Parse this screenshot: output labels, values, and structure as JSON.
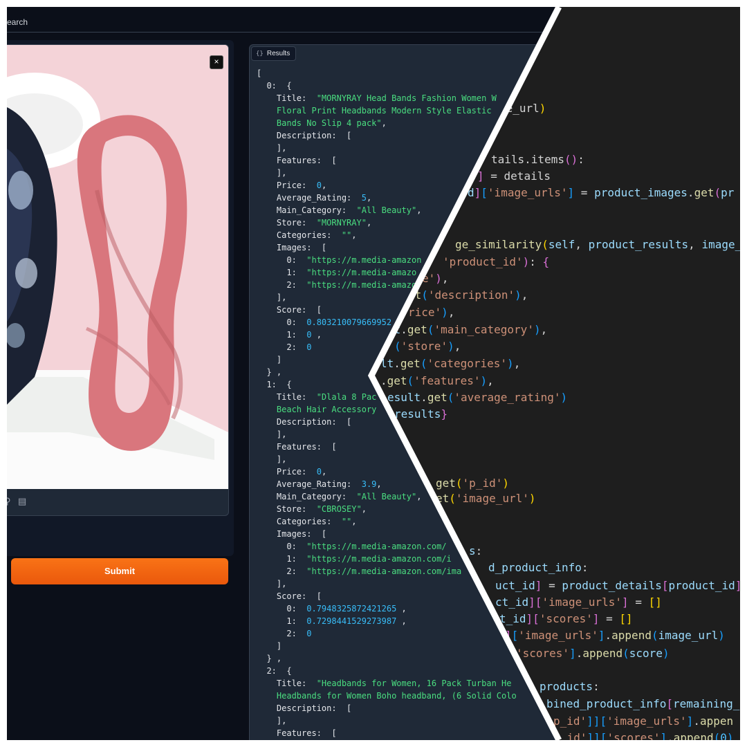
{
  "topbar": {
    "tab_label": "earch"
  },
  "image_panel": {
    "close_symbol": "×",
    "tool_icons": [
      "search-icon",
      "clipboard-icon"
    ]
  },
  "submit_button": {
    "label": "Submit"
  },
  "results_panel": {
    "label": "Results",
    "label_icon": "{}"
  },
  "json_lines": [
    [
      [
        "p",
        "["
      ]
    ],
    [
      [
        "p",
        "  0:  {"
      ]
    ],
    [
      [
        "k",
        "    Title:  "
      ],
      [
        "s",
        "\"MORNYRAY Head Bands Fashion Women W"
      ]
    ],
    [
      [
        "s",
        "    Floral Print Headbands Modern Style Elastic"
      ]
    ],
    [
      [
        "s",
        "    Bands No Slip 4 pack\""
      ],
      [
        "p",
        ","
      ]
    ],
    [
      [
        "k",
        "    Description:  ["
      ]
    ],
    [
      [
        "p",
        "    ],"
      ]
    ],
    [
      [
        "k",
        "    Features:  ["
      ]
    ],
    [
      [
        "p",
        "    ],"
      ]
    ],
    [
      [
        "k",
        "    Price:  "
      ],
      [
        "n",
        "0"
      ],
      [
        "p",
        ","
      ]
    ],
    [
      [
        "k",
        "    Average_Rating:  "
      ],
      [
        "n",
        "5"
      ],
      [
        "p",
        ","
      ]
    ],
    [
      [
        "k",
        "    Main_Category:  "
      ],
      [
        "s",
        "\"All Beauty\""
      ],
      [
        "p",
        ","
      ]
    ],
    [
      [
        "k",
        "    Store:  "
      ],
      [
        "s",
        "\"MORNYRAY\""
      ],
      [
        "p",
        ","
      ]
    ],
    [
      [
        "k",
        "    Categories:  "
      ],
      [
        "s",
        "\"\""
      ],
      [
        "p",
        ","
      ]
    ],
    [
      [
        "k",
        "    Images:  ["
      ]
    ],
    [
      [
        "k",
        "      0:  "
      ],
      [
        "s",
        "\"https://m.media-amazon"
      ]
    ],
    [
      [
        "k",
        "      1:  "
      ],
      [
        "s",
        "\"https://m.media-amazo"
      ]
    ],
    [
      [
        "k",
        "      2:  "
      ],
      [
        "s",
        "\"https://m.media-amazo"
      ]
    ],
    [
      [
        "p",
        "    ],"
      ]
    ],
    [
      [
        "k",
        "    Score:  ["
      ]
    ],
    [
      [
        "k",
        "      0:  "
      ],
      [
        "n",
        "0.803210079669952"
      ]
    ],
    [
      [
        "k",
        "      1:  "
      ],
      [
        "n",
        "0"
      ],
      [
        "p",
        " ,"
      ]
    ],
    [
      [
        "k",
        "      2:  "
      ],
      [
        "n",
        "0"
      ]
    ],
    [
      [
        "p",
        "    ]"
      ]
    ],
    [
      [
        "p",
        "  } ,"
      ]
    ],
    [
      [
        "p",
        "  1:  {"
      ]
    ],
    [
      [
        "k",
        "    Title:  "
      ],
      [
        "s",
        "\"Dlala 8 Pac"
      ]
    ],
    [
      [
        "s",
        "    Beach Hair Accessory"
      ]
    ],
    [
      [
        "k",
        "    Description:  ["
      ]
    ],
    [
      [
        "p",
        "    ],"
      ]
    ],
    [
      [
        "k",
        "    Features:  ["
      ]
    ],
    [
      [
        "p",
        "    ],"
      ]
    ],
    [
      [
        "k",
        "    Price:  "
      ],
      [
        "n",
        "0"
      ],
      [
        "p",
        ","
      ]
    ],
    [
      [
        "k",
        "    Average_Rating:  "
      ],
      [
        "n",
        "3.9"
      ],
      [
        "p",
        ","
      ]
    ],
    [
      [
        "k",
        "    Main_Category:  "
      ],
      [
        "s",
        "\"All Beauty\""
      ],
      [
        "p",
        ","
      ]
    ],
    [
      [
        "k",
        "    Store:  "
      ],
      [
        "s",
        "\"CBROSEY\""
      ],
      [
        "p",
        ","
      ]
    ],
    [
      [
        "k",
        "    Categories:  "
      ],
      [
        "s",
        "\"\""
      ],
      [
        "p",
        ","
      ]
    ],
    [
      [
        "k",
        "    Images:  ["
      ]
    ],
    [
      [
        "k",
        "      0:  "
      ],
      [
        "s",
        "\"https://m.media-amazon.com/"
      ]
    ],
    [
      [
        "k",
        "      1:  "
      ],
      [
        "s",
        "\"https://m.media-amazon.com/i"
      ]
    ],
    [
      [
        "k",
        "      2:  "
      ],
      [
        "s",
        "\"https://m.media-amazon.com/ima"
      ]
    ],
    [
      [
        "p",
        "    ],"
      ]
    ],
    [
      [
        "k",
        "    Score:  ["
      ]
    ],
    [
      [
        "k",
        "      0:  "
      ],
      [
        "n",
        "0.7948325872421265"
      ],
      [
        "p",
        " ,"
      ]
    ],
    [
      [
        "k",
        "      1:  "
      ],
      [
        "n",
        "0.7298441529273987"
      ],
      [
        "p",
        " ,"
      ]
    ],
    [
      [
        "k",
        "      2:  "
      ],
      [
        "n",
        "0"
      ]
    ],
    [
      [
        "p",
        "    ]"
      ]
    ],
    [
      [
        "p",
        "  } ,"
      ]
    ],
    [
      [
        "p",
        "  2:  {"
      ]
    ],
    [
      [
        "k",
        "    Title:  "
      ],
      [
        "s",
        "\"Headbands for Women, 16 Pack Turban He"
      ]
    ],
    [
      [
        "s",
        "    Headbands for Women Boho headband, (6 Solid Colo"
      ]
    ],
    [
      [
        "k",
        "    Description:  ["
      ]
    ],
    [
      [
        "p",
        "    ],"
      ]
    ],
    [
      [
        "k",
        "    Features:  ["
      ]
    ]
  ],
  "code_lines": [
    [
      [
        "c-w",
        "ge_url"
      ],
      [
        "c-g",
        ")"
      ]
    ],
    [
      [
        "c-w",
        "tails.items"
      ],
      [
        "c-p",
        "()"
      ],
      [
        "c-w",
        ":"
      ]
    ],
    [
      [
        "c-p",
        "]"
      ],
      [
        "c-w",
        " = details"
      ]
    ],
    [
      [
        "c-l",
        "d"
      ],
      [
        "c-p",
        "]"
      ],
      [
        "c-b",
        "["
      ],
      [
        "c-o",
        "'image_urls'"
      ],
      [
        "c-b",
        "]"
      ],
      [
        "c-w",
        " = "
      ],
      [
        "c-l",
        "product_images"
      ],
      [
        "c-w",
        "."
      ],
      [
        "c-y",
        "get"
      ],
      [
        "c-p",
        "("
      ],
      [
        "c-l",
        "pr"
      ]
    ],
    [
      [
        "c-y",
        "ge_similarity"
      ],
      [
        "c-g",
        "("
      ],
      [
        "c-l",
        "self"
      ],
      [
        "c-w",
        ", "
      ],
      [
        "c-l",
        "product_results"
      ],
      [
        "c-w",
        ", "
      ],
      [
        "c-l",
        "image_"
      ]
    ],
    [
      [
        "c-o",
        "'product_id'"
      ],
      [
        "c-p",
        ")"
      ],
      [
        "c-w",
        ": "
      ],
      [
        "c-p",
        "{"
      ]
    ],
    [
      [
        "c-o",
        "e'"
      ],
      [
        "c-p",
        ")"
      ],
      [
        "c-w",
        ","
      ]
    ],
    [
      [
        "c-y",
        "et"
      ],
      [
        "c-b",
        "("
      ],
      [
        "c-o",
        "'description'"
      ],
      [
        "c-b",
        ")"
      ],
      [
        "c-w",
        ","
      ]
    ],
    [
      [
        "c-o",
        "rice'"
      ],
      [
        "c-b",
        ")"
      ],
      [
        "c-w",
        ","
      ]
    ],
    [
      [
        "c-l",
        "lt"
      ],
      [
        "c-w",
        "."
      ],
      [
        "c-y",
        "get"
      ],
      [
        "c-b",
        "("
      ],
      [
        "c-o",
        "'main_category'"
      ],
      [
        "c-b",
        ")"
      ],
      [
        "c-w",
        ","
      ]
    ],
    [
      [
        "c-b",
        "("
      ],
      [
        "c-o",
        "'store'"
      ],
      [
        "c-b",
        ")"
      ],
      [
        "c-w",
        ","
      ]
    ],
    [
      [
        "c-l",
        "lt"
      ],
      [
        "c-w",
        "."
      ],
      [
        "c-y",
        "get"
      ],
      [
        "c-b",
        "("
      ],
      [
        "c-o",
        "'categories'"
      ],
      [
        "c-b",
        ")"
      ],
      [
        "c-w",
        ","
      ]
    ],
    [
      [
        "c-w",
        "."
      ],
      [
        "c-y",
        "get"
      ],
      [
        "c-b",
        "("
      ],
      [
        "c-o",
        "'features'"
      ],
      [
        "c-b",
        ")"
      ],
      [
        "c-w",
        ","
      ]
    ],
    [
      [
        "c-l",
        "esult"
      ],
      [
        "c-w",
        "."
      ],
      [
        "c-y",
        "get"
      ],
      [
        "c-b",
        "("
      ],
      [
        "c-o",
        "'average_rating'"
      ],
      [
        "c-b",
        ")"
      ]
    ],
    [
      [
        "c-l",
        "results"
      ],
      [
        "c-p",
        "}"
      ]
    ],
    [
      [
        "c-y",
        "get"
      ],
      [
        "c-g",
        "("
      ],
      [
        "c-o",
        "'p_id'"
      ],
      [
        "c-g",
        ")"
      ]
    ],
    [
      [
        "c-y",
        "et"
      ],
      [
        "c-g",
        "("
      ],
      [
        "c-o",
        "'image_url'"
      ],
      [
        "c-g",
        ")"
      ]
    ],
    [
      [
        "c-l",
        "s"
      ],
      [
        "c-w",
        ":"
      ]
    ],
    [
      [
        "c-l",
        "d_product_info"
      ],
      [
        "c-w",
        ":"
      ]
    ],
    [
      [
        "c-l",
        "uct_id"
      ],
      [
        "c-p",
        "]"
      ],
      [
        "c-w",
        " = "
      ],
      [
        "c-l",
        "product_details"
      ],
      [
        "c-p",
        "["
      ],
      [
        "c-l",
        "product_id"
      ],
      [
        "c-p",
        "]"
      ]
    ],
    [
      [
        "c-l",
        "ct_id"
      ],
      [
        "c-p",
        "]"
      ],
      [
        "c-p",
        "["
      ],
      [
        "c-o",
        "'image_urls'"
      ],
      [
        "c-p",
        "]"
      ],
      [
        "c-w",
        " = "
      ],
      [
        "c-g",
        "[]"
      ]
    ],
    [
      [
        "c-l",
        "t_id"
      ],
      [
        "c-p",
        "]"
      ],
      [
        "c-p",
        "["
      ],
      [
        "c-o",
        "'scores'"
      ],
      [
        "c-p",
        "]"
      ],
      [
        "c-w",
        " = "
      ],
      [
        "c-g",
        "[]"
      ]
    ],
    [
      [
        "c-p",
        "]"
      ],
      [
        "c-b",
        "["
      ],
      [
        "c-o",
        "'image_urls'"
      ],
      [
        "c-b",
        "]"
      ],
      [
        "c-w",
        "."
      ],
      [
        "c-y",
        "append"
      ],
      [
        "c-b",
        "("
      ],
      [
        "c-l",
        "image_url"
      ],
      [
        "c-b",
        ")"
      ]
    ],
    [
      [
        "c-o",
        "'scores'"
      ],
      [
        "c-b",
        "]"
      ],
      [
        "c-w",
        "."
      ],
      [
        "c-y",
        "append"
      ],
      [
        "c-b",
        "("
      ],
      [
        "c-l",
        "score"
      ],
      [
        "c-b",
        ")"
      ]
    ],
    [
      [
        "c-l",
        "products"
      ],
      [
        "c-w",
        ":"
      ]
    ],
    [
      [
        "c-l",
        "bined_product_info"
      ],
      [
        "c-p",
        "["
      ],
      [
        "c-l",
        "remaining_"
      ]
    ],
    [
      [
        "c-o",
        "p_id'"
      ],
      [
        "c-b",
        "]]"
      ],
      [
        "c-b",
        "["
      ],
      [
        "c-o",
        "'image_urls'"
      ],
      [
        "c-b",
        "]"
      ],
      [
        "c-w",
        "."
      ],
      [
        "c-y",
        "appen"
      ]
    ],
    [
      [
        "c-o",
        "_id'"
      ],
      [
        "c-b",
        "]]"
      ],
      [
        "c-b",
        "["
      ],
      [
        "c-o",
        "'scores'"
      ],
      [
        "c-b",
        "]"
      ],
      [
        "c-w",
        "."
      ],
      [
        "c-y",
        "append"
      ],
      [
        "c-b",
        "("
      ],
      [
        "c-t",
        "0"
      ],
      [
        "c-b",
        ")"
      ]
    ]
  ]
}
